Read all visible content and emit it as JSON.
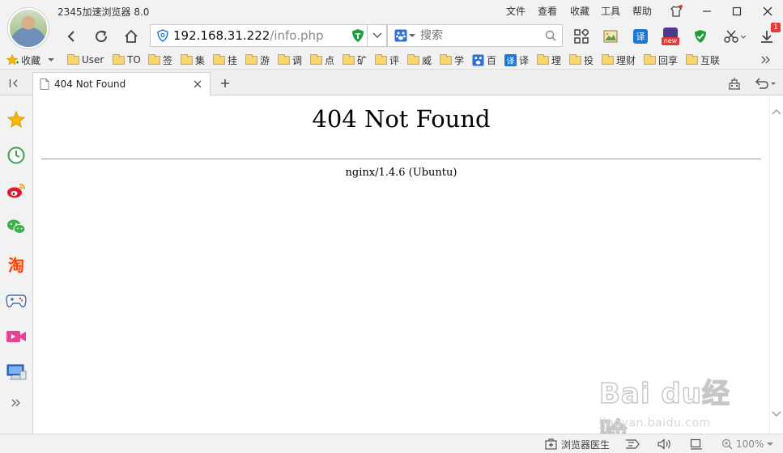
{
  "window": {
    "title": "2345加速浏览器 8.0",
    "menu": [
      "文件",
      "查看",
      "收藏",
      "工具",
      "帮助"
    ]
  },
  "toolbar": {
    "url_host": "192.168.31.222",
    "url_path": "/info.php",
    "search_placeholder": "搜索",
    "translate_glyph": "译",
    "new_badge": "new",
    "notify_badge": "1"
  },
  "bookmarks": {
    "favorites_label": "收藏",
    "items": [
      "User",
      "TO",
      "签",
      "集",
      "挂",
      "游",
      "调",
      "点",
      "矿",
      "评",
      "威",
      "学",
      "百",
      "译",
      "理",
      "投",
      "理财",
      "回享",
      "互联"
    ]
  },
  "tabs": [
    {
      "title": "404 Not Found"
    }
  ],
  "page": {
    "heading": "404 Not Found",
    "server": "nginx/1.4.6 (Ubuntu)"
  },
  "sidebar": {
    "icons": [
      "star-icon",
      "history-icon",
      "weibo-icon",
      "wechat-icon",
      "taobao-icon",
      "gamepad-icon",
      "video-icon",
      "computer-icon"
    ],
    "taobao_glyph": "淘"
  },
  "statusbar": {
    "doctor_label": "浏览器医生",
    "zoom": "100%"
  },
  "watermark": {
    "text": "Bai du经验",
    "url": "jingyan.baidu.com"
  },
  "colors": {
    "chrome_bg": "#f2f2f2",
    "accent_blue": "#1a78d6",
    "folder_yellow": "#f7d774",
    "badge_red": "#e53935"
  }
}
